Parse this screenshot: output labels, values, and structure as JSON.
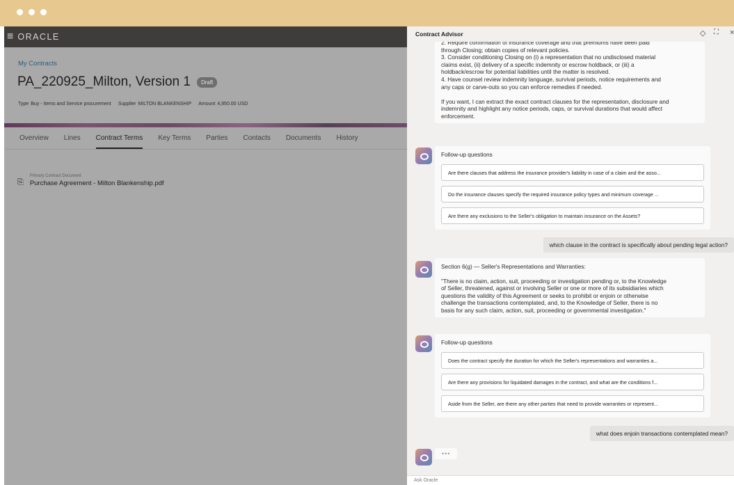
{
  "app": {
    "logo": "ORACLE"
  },
  "breadcrumb": "My Contracts",
  "contract": {
    "title": "PA_220925_Milton, Version 1",
    "status": "Draft",
    "type_label": "Type",
    "type_value": "Buy - Items and Service procurement",
    "supplier_label": "Supplier",
    "supplier_value": "MILTON BLANKENSHIP",
    "amount_label": "Amount",
    "amount_value": "4,950.00 USD"
  },
  "tabs": [
    "Overview",
    "Lines",
    "Contract Terms",
    "Key Terms",
    "Parties",
    "Contacts",
    "Documents",
    "History"
  ],
  "active_tab": "Contract Terms",
  "document": {
    "caption": "Primary Contract Document",
    "file": "Purchase Agreement - Milton Blankenship.pdf"
  },
  "advisor": {
    "title": "Contract Advisor",
    "msg1_lines": [
      "2. Require confirmation of insurance coverage and that premiums have been paid",
      "through Closing; obtain copies of relevant policies.",
      "3. Consider conditioning Closing on (i) a representation that no undisclosed material",
      "claims exist, (ii) delivery of a specific indemnity or escrow holdback, or (iii) a",
      "holdback/escrow for potential liabilities until the matter is resolved.",
      "4. Have counsel review indemnity language, survival periods, notice requirements and",
      "any caps or carve-outs so you can enforce remedies if needed.",
      "",
      "If you want, I can extract the exact contract clauses for the representation, disclosure and",
      "indemnity and highlight any notice periods, caps, or survival durations that would affect",
      "enforcement."
    ],
    "followup_title": "Follow-up questions",
    "followups1": [
      "Are there clauses that address the insurance provider's liability in case of a claim and the asso...",
      "Do the insurance clauses specify the required insurance policy types and minimum coverage ...",
      "Are there any exclusions to the Seller's obligation to maintain insurance on the Assets?"
    ],
    "user_q1": "which clause in the contract is specifically about pending legal action?",
    "answer2_heading": "Section 6(g) — Seller's Representations and Warranties:",
    "answer2_lines": [
      "\"There is no claim, action, suit, proceeding or investigation pending or, to the Knowledge",
      "of Seller, threatened, against or involving Seller or one or more of its subsidiaries which",
      "questions the validity of this Agreement or seeks to prohibit or enjoin or otherwise",
      "challenge the transactions contemplated, and, to the Knowledge of Seller, there is no",
      "basis for any such claim, action, suit, proceeding or governmental investigation.\""
    ],
    "followups2": [
      "Does the contract specify the duration for which the Seller's representations and warranties a...",
      "Are there any provisions for liquidated damages in the contract, and what are the conditions f...",
      "Aside from the Seller, are there any other parties that need to provide warranties or represent..."
    ],
    "user_q2": "what does enjoin transactions contemplated mean?",
    "typing": "•••",
    "ask_placeholder": "Ask Oracle"
  },
  "icons": {
    "menu": "hamburger-icon",
    "clip": "paperclip-icon",
    "pin": "pin-icon",
    "expand": "expand-icon",
    "close": "close-icon"
  }
}
